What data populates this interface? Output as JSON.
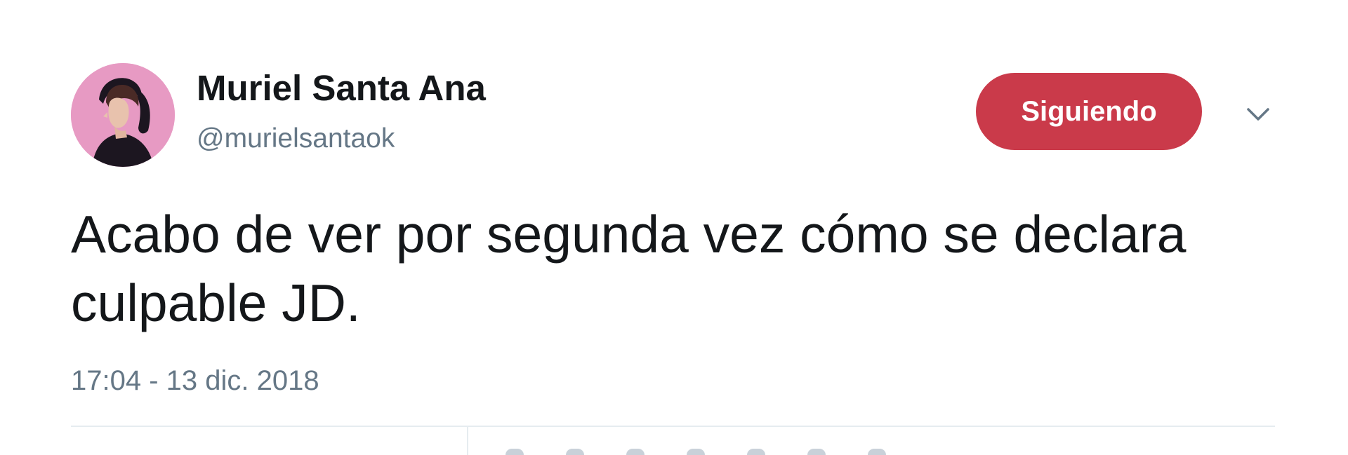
{
  "user": {
    "name": "Muriel Santa Ana",
    "handle": "@murielsantaok"
  },
  "follow_button": {
    "label": "Siguiendo",
    "color": "#ca3a4a"
  },
  "menu_icon": "chevron-down-icon",
  "tweet": {
    "text": "Acabo de ver por segunda vez cómo se declara culpable JD.",
    "timestamp": "17:04 - 13 dic. 2018"
  },
  "colors": {
    "text": "#14171a",
    "secondary": "#657786",
    "divider": "#e6ecf0",
    "avatar_background": "#e79ac3"
  }
}
